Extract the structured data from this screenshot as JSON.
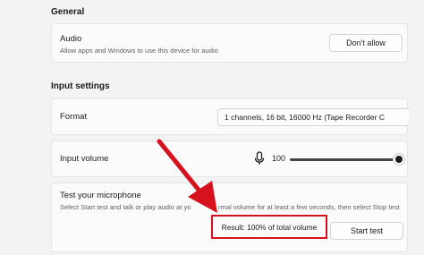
{
  "sections": {
    "general_heading": "General",
    "input_heading": "Input settings"
  },
  "audio": {
    "title": "Audio",
    "description": "Allow apps and Windows to use this device for audio",
    "button_label": "Don't allow"
  },
  "format": {
    "title": "Format",
    "selected_value": "1 channels, 16 bit, 16000 Hz (Tape Recorder C"
  },
  "input_volume": {
    "title": "Input volume",
    "value_text": "100",
    "level": 100
  },
  "test_mic": {
    "title": "Test your microphone",
    "description_start": "Select Start test and talk or play audio at yo",
    "description_end": "rmal volume for at least a few seconds, then select Stop test",
    "result_text": "Result: 100% of total volume",
    "button_label": "Start test"
  },
  "colors": {
    "annotation_red": "#d6121f",
    "page_bg": "#f3f3f3",
    "card_bg": "#fbfbfb"
  },
  "icons": {
    "microphone": "microphone-icon",
    "chevron": "chevron-down-icon",
    "arrow": "annotation-arrow-icon"
  }
}
